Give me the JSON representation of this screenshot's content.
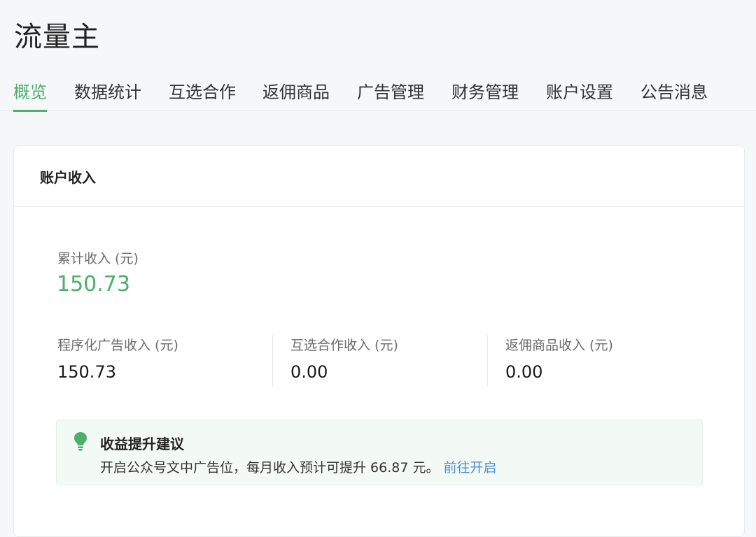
{
  "app": {
    "title": "流量主"
  },
  "tabs": [
    {
      "label": "概览",
      "active": true
    },
    {
      "label": "数据统计"
    },
    {
      "label": "互选合作"
    },
    {
      "label": "返佣商品"
    },
    {
      "label": "广告管理"
    },
    {
      "label": "财务管理"
    },
    {
      "label": "账户设置"
    },
    {
      "label": "公告消息"
    }
  ],
  "income": {
    "header": "账户收入",
    "total_label": "累计收入 (元)",
    "total_value": "150.73",
    "stats": [
      {
        "label": "程序化广告收入 (元)",
        "value": "150.73"
      },
      {
        "label": "互选合作收入 (元)",
        "value": "0.00"
      },
      {
        "label": "返佣商品收入 (元)",
        "value": "0.00"
      }
    ]
  },
  "tip": {
    "icon": "lightbulb-icon",
    "title": "收益提升建议",
    "text": "开启公众号文中广告位，每月收入预计可提升 66.87 元。",
    "link": "前往开启"
  },
  "colors": {
    "accent": "#4caf6a",
    "link": "#4a8fd8",
    "tip_background": "#f3f9f5"
  }
}
